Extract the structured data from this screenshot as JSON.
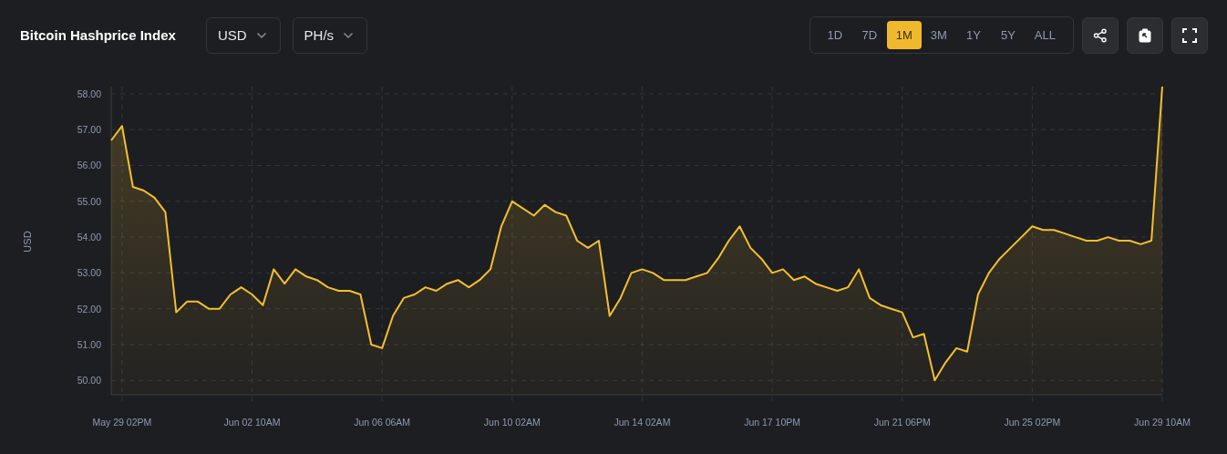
{
  "header": {
    "title": "Bitcoin Hashprice Index",
    "currency_select": {
      "value": "USD"
    },
    "unit_select": {
      "value": "PH/s"
    },
    "ranges": [
      {
        "label": "1D",
        "selected": false
      },
      {
        "label": "7D",
        "selected": false
      },
      {
        "label": "1M",
        "selected": true
      },
      {
        "label": "3M",
        "selected": false
      },
      {
        "label": "1Y",
        "selected": false
      },
      {
        "label": "5Y",
        "selected": false
      },
      {
        "label": "ALL",
        "selected": false
      }
    ]
  },
  "chart": {
    "chart_data": {
      "type": "area",
      "ylabel": "USD",
      "categories": [
        null,
        "May 29 02PM",
        null,
        null,
        null,
        null,
        null,
        null,
        null,
        null,
        null,
        null,
        null,
        "Jun 02 10AM",
        null,
        null,
        null,
        null,
        null,
        null,
        null,
        null,
        null,
        null,
        null,
        "Jun 06 06AM",
        null,
        null,
        null,
        null,
        null,
        null,
        null,
        null,
        null,
        null,
        null,
        "Jun 10 02AM",
        null,
        null,
        null,
        null,
        null,
        null,
        null,
        null,
        null,
        null,
        null,
        "Jun 14 02AM",
        null,
        null,
        null,
        null,
        null,
        null,
        null,
        null,
        null,
        null,
        null,
        "Jun 17 10PM",
        null,
        null,
        null,
        null,
        null,
        null,
        null,
        null,
        null,
        null,
        null,
        "Jun 21 06PM",
        null,
        null,
        null,
        null,
        null,
        null,
        null,
        null,
        null,
        null,
        null,
        "Jun 25 02PM",
        null,
        null,
        null,
        null,
        null,
        null,
        null,
        null,
        null,
        null,
        null,
        "Jun 29 10AM"
      ],
      "series": [
        {
          "color": "#f4bf2f",
          "values": [
            56.7,
            57.1,
            55.4,
            55.3,
            55.1,
            54.7,
            51.9,
            52.2,
            52.2,
            52.0,
            52.0,
            52.4,
            52.6,
            52.4,
            52.1,
            53.1,
            52.7,
            53.1,
            52.9,
            52.8,
            52.6,
            52.5,
            52.5,
            52.4,
            51.0,
            50.9,
            51.8,
            52.3,
            52.4,
            52.6,
            52.5,
            52.7,
            52.8,
            52.6,
            52.8,
            53.1,
            54.3,
            55.0,
            54.8,
            54.6,
            54.9,
            54.7,
            54.6,
            53.9,
            53.7,
            53.9,
            51.8,
            52.3,
            53.0,
            53.1,
            53.0,
            52.8,
            52.8,
            52.8,
            52.9,
            53.0,
            53.4,
            53.9,
            54.3,
            53.7,
            53.4,
            53.0,
            53.1,
            52.8,
            52.9,
            52.7,
            52.6,
            52.5,
            52.6,
            53.1,
            52.3,
            52.1,
            52.0,
            51.9,
            51.2,
            51.3,
            50.0,
            50.5,
            50.9,
            50.8,
            52.4,
            53.0,
            53.4,
            53.7,
            54.0,
            54.3,
            54.2,
            54.2,
            54.1,
            54.0,
            53.9,
            53.9,
            54.0,
            53.9,
            53.9,
            53.8,
            53.9,
            58.2
          ]
        }
      ],
      "ylim": [
        49.6,
        58.2
      ],
      "grid": true,
      "yticks": [
        {
          "value": 50,
          "label": "50.00"
        },
        {
          "value": 51,
          "label": "51.00"
        },
        {
          "value": 52,
          "label": "52.00"
        },
        {
          "value": 53,
          "label": "53.00"
        },
        {
          "value": 54,
          "label": "54.00"
        },
        {
          "value": 55,
          "label": "55.00"
        },
        {
          "value": 56,
          "label": "56.00"
        },
        {
          "value": 57,
          "label": "57.00"
        },
        {
          "value": 58,
          "label": "58.00"
        }
      ]
    }
  }
}
